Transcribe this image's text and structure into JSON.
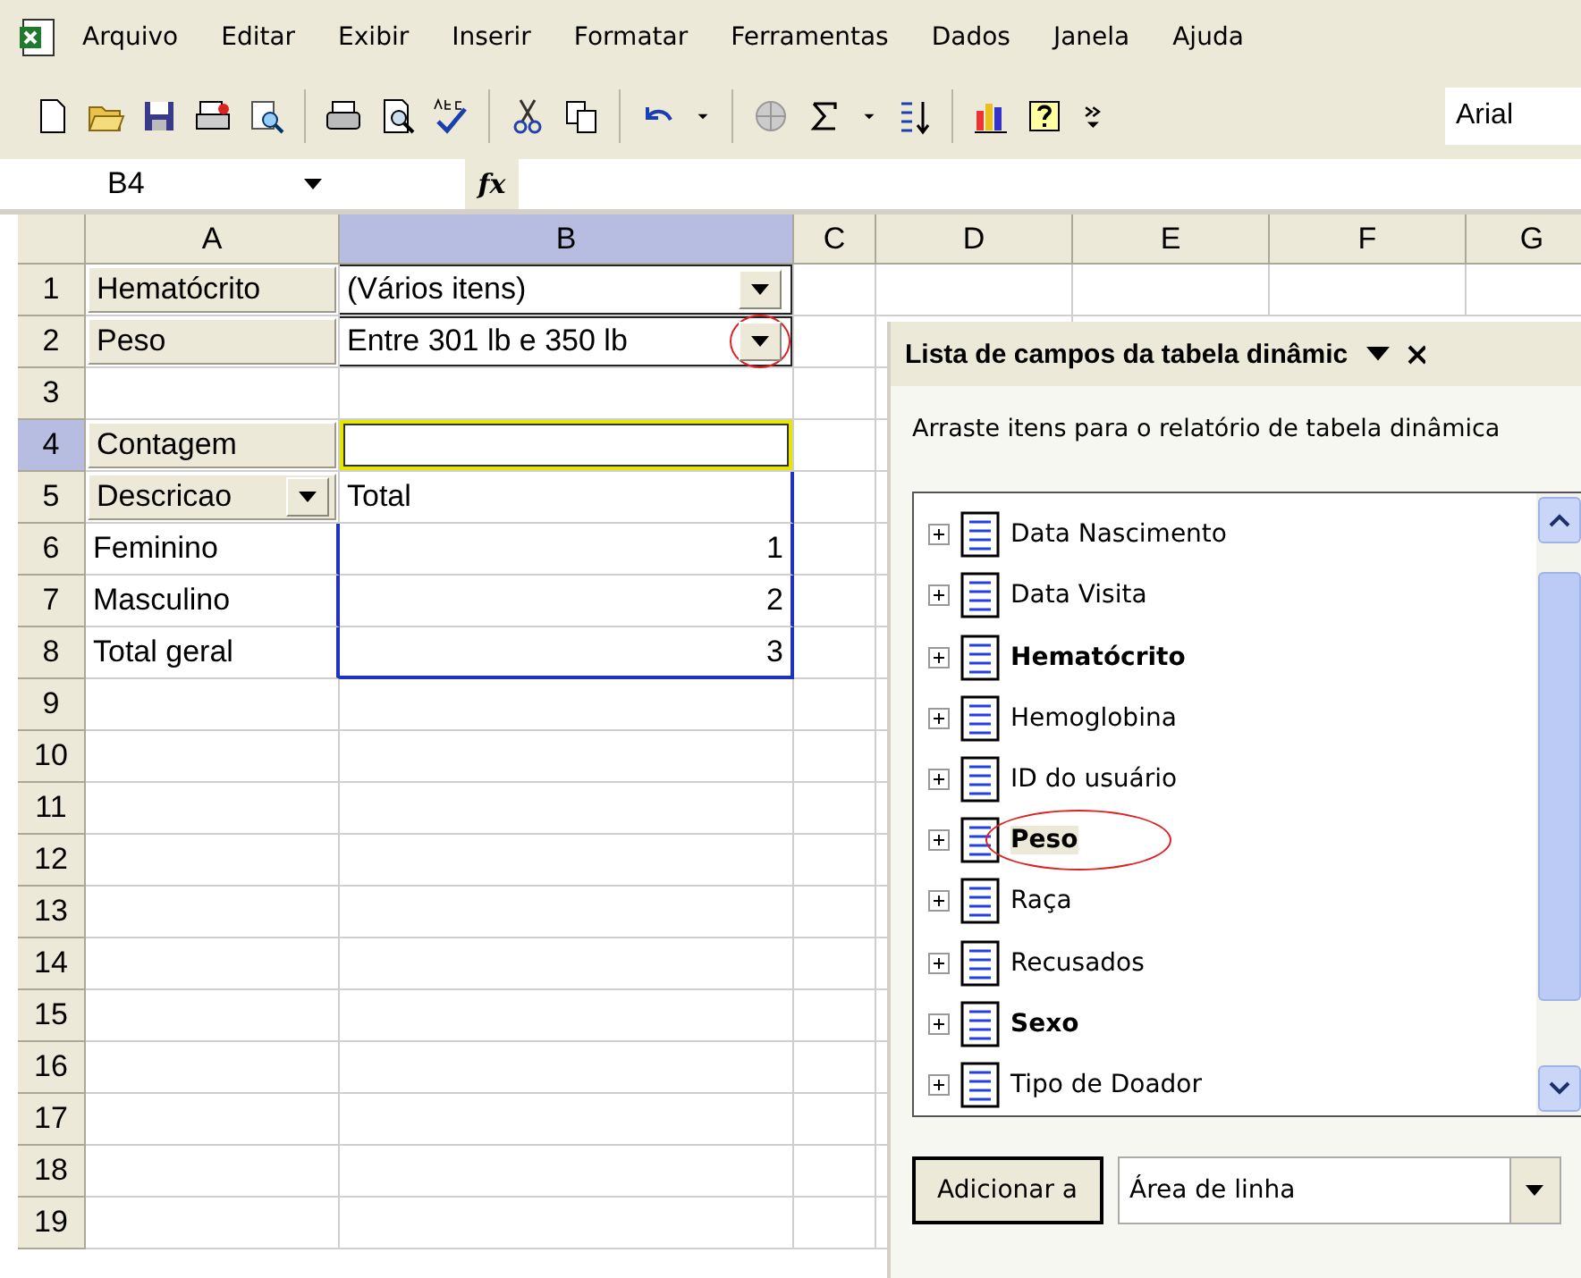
{
  "menu": [
    {
      "label": "Arquivo"
    },
    {
      "label": "Editar"
    },
    {
      "label": "Exibir"
    },
    {
      "label": "Inserir"
    },
    {
      "label": "Formatar"
    },
    {
      "label": "Ferramentas"
    },
    {
      "label": "Dados"
    },
    {
      "label": "Janela"
    },
    {
      "label": "Ajuda"
    }
  ],
  "toolbar": {
    "font": "Arial"
  },
  "formula_bar": {
    "name_box": "B4",
    "function_label": "fx"
  },
  "columns": [
    {
      "label": "A",
      "selected": false
    },
    {
      "label": "B",
      "selected": true
    },
    {
      "label": "C",
      "selected": false
    },
    {
      "label": "D",
      "selected": false
    },
    {
      "label": "E",
      "selected": false
    },
    {
      "label": "F",
      "selected": false
    },
    {
      "label": "G",
      "selected": false
    }
  ],
  "rows": [
    {
      "header": "1",
      "selected": false,
      "a": {
        "kind": "field",
        "text": "Hematócrito"
      },
      "b": {
        "kind": "page",
        "text": "(Vários itens)",
        "highlighted": false
      }
    },
    {
      "header": "2",
      "selected": false,
      "a": {
        "kind": "field",
        "text": "Peso"
      },
      "b": {
        "kind": "page",
        "text": "Entre 301 lb e 350 lb",
        "highlighted": true
      }
    },
    {
      "header": "3",
      "selected": false
    },
    {
      "header": "4",
      "selected": true,
      "a": {
        "kind": "field",
        "text": "Contagem"
      },
      "b": {
        "kind": "active",
        "selected": true
      }
    },
    {
      "header": "5",
      "selected": false,
      "a": {
        "kind": "field_dropdown",
        "text": "Descricao"
      },
      "b": {
        "kind": "text",
        "text": "Total"
      }
    },
    {
      "header": "6",
      "selected": false,
      "a": {
        "kind": "text",
        "text": "Feminino"
      },
      "b": {
        "kind": "number",
        "text": "1"
      }
    },
    {
      "header": "7",
      "selected": false,
      "a": {
        "kind": "text",
        "text": "Masculino"
      },
      "b": {
        "kind": "number",
        "text": "2"
      }
    },
    {
      "header": "8",
      "selected": false,
      "a": {
        "kind": "text",
        "text": "Total geral"
      },
      "b": {
        "kind": "number",
        "text": "3"
      }
    },
    {
      "header": "9",
      "selected": false
    },
    {
      "header": "10",
      "selected": false
    },
    {
      "header": "11",
      "selected": false
    },
    {
      "header": "12",
      "selected": false
    },
    {
      "header": "13",
      "selected": false
    },
    {
      "header": "14",
      "selected": false
    },
    {
      "header": "15",
      "selected": false
    },
    {
      "header": "16",
      "selected": false
    },
    {
      "header": "17",
      "selected": false
    },
    {
      "header": "18",
      "selected": false
    },
    {
      "header": "19",
      "selected": false
    }
  ],
  "field_list": {
    "title": "Lista de campos da tabela dinâmic",
    "description": "Arraste itens para o relatório de tabela dinâmica",
    "fields": [
      {
        "name": "Data Nascimento",
        "in_use": false,
        "highlighted": false
      },
      {
        "name": "Data Visita",
        "in_use": false,
        "highlighted": false
      },
      {
        "name": "Hematócrito",
        "in_use": true,
        "highlighted": false
      },
      {
        "name": "Hemoglobina",
        "in_use": false,
        "highlighted": false
      },
      {
        "name": "ID do usuário",
        "in_use": false,
        "highlighted": false
      },
      {
        "name": "Peso",
        "in_use": true,
        "highlighted": true
      },
      {
        "name": "Raça",
        "in_use": false,
        "highlighted": false
      },
      {
        "name": "Recusados",
        "in_use": false,
        "highlighted": false
      },
      {
        "name": "Sexo",
        "in_use": true,
        "highlighted": false
      },
      {
        "name": "Tipo de Doador",
        "in_use": false,
        "highlighted": false
      }
    ],
    "add_button": "Adicionar a",
    "area_select": "Área de linha"
  }
}
